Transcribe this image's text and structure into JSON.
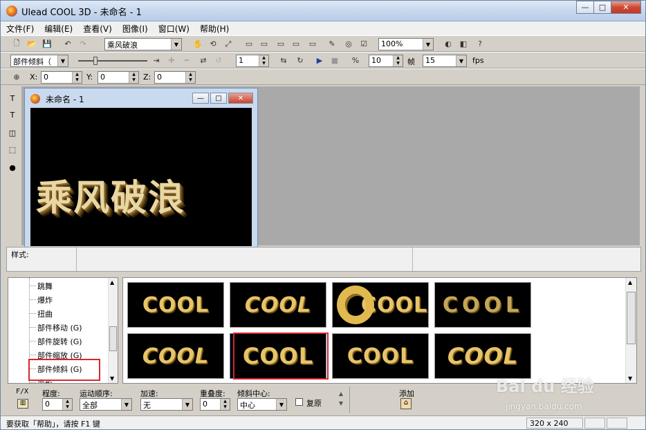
{
  "window": {
    "title": "Ulead COOL 3D - 未命名 - 1",
    "min": "—",
    "max": "□",
    "close": "✕"
  },
  "menu": [
    "文件(F)",
    "编辑(E)",
    "查看(V)",
    "图像(I)",
    "窗口(W)",
    "帮助(H)"
  ],
  "toolbar1": {
    "text_combo": "乘风破浪",
    "zoom": "100%"
  },
  "toolbar2": {
    "object_combo": "部件倾斜（",
    "frame_number": "1",
    "frames": "10",
    "frame_label": "帧",
    "fps_value": "15",
    "fps_label": "fps"
  },
  "toolbar3": {
    "x_label": "X:",
    "x": "0",
    "y_label": "Y:",
    "y": "0",
    "z_label": "Z:",
    "z": "0"
  },
  "document": {
    "title": "未命名 - 1",
    "text": "乘风破浪"
  },
  "style_panel": {
    "label": "样式:"
  },
  "tree": [
    "跳舞",
    "爆炸",
    "扭曲",
    "部件移动 (G)",
    "部件旋转 (G)",
    "部件缩放 (G)",
    "部件倾斜 (G)",
    "变形"
  ],
  "thumbnails": [
    "COOL",
    "COOL",
    "COOL",
    "COOL",
    "COOL",
    "COOL",
    "COOL",
    "COOL"
  ],
  "params": {
    "fx_label": "F/X",
    "degree_label": "程度:",
    "degree_value": "0",
    "order_label": "运动顺序:",
    "order_value": "全部",
    "accel_label": "加速:",
    "accel_value": "无",
    "overlap_label": "重叠度:",
    "overlap_value": "0",
    "center_label": "倾斜中心:",
    "center_value": "中心",
    "restore_label": "复原",
    "add_label": "添加"
  },
  "status": {
    "help_text": "要获取「帮助」，请按 F1 键",
    "size": "320 x 240"
  },
  "watermark": {
    "brand": "Bai du 经验",
    "url": "jingyan.baidu.com"
  },
  "colors": {
    "highlight": "#d9262b",
    "gold": "#e7c468"
  }
}
